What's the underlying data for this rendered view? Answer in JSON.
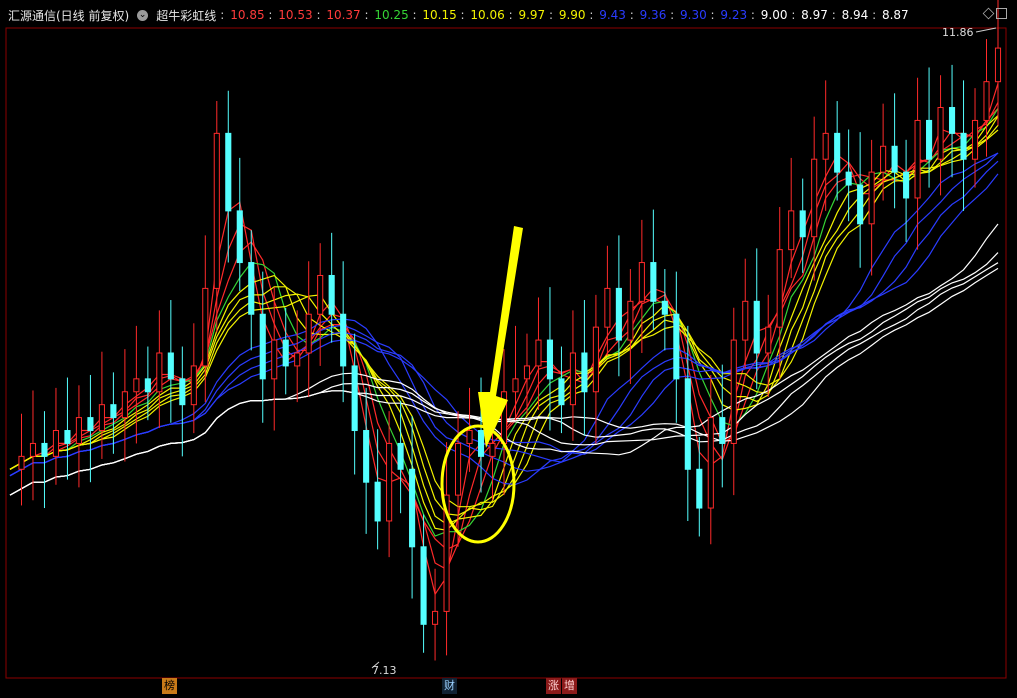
{
  "header": {
    "stock_title": "汇源通信(日线 前复权)",
    "indicator_name": "超牛彩虹线",
    "values": [
      {
        "text": "10.85",
        "color": "#ff3b3b"
      },
      {
        "text": "10.53",
        "color": "#ff3b3b"
      },
      {
        "text": "10.37",
        "color": "#ff3b3b"
      },
      {
        "text": "10.25",
        "color": "#35d435"
      },
      {
        "text": "10.15",
        "color": "#f2f200"
      },
      {
        "text": "10.06",
        "color": "#f2f200"
      },
      {
        "text": "9.97",
        "color": "#f2f200"
      },
      {
        "text": "9.90",
        "color": "#f2f200"
      },
      {
        "text": "9.43",
        "color": "#2a3cff"
      },
      {
        "text": "9.36",
        "color": "#2a3cff"
      },
      {
        "text": "9.30",
        "color": "#2a3cff"
      },
      {
        "text": "9.23",
        "color": "#2a3cff"
      },
      {
        "text": "9.00",
        "color": "#ffffff"
      },
      {
        "text": "8.97",
        "color": "#ffffff"
      },
      {
        "text": "8.94",
        "color": "#ffffff"
      },
      {
        "text": "8.87",
        "color": "#ffffff"
      }
    ]
  },
  "chart_data": {
    "type": "line",
    "peak_label": "11.86",
    "low_label": "7.13",
    "y_range": [
      7.0,
      12.0
    ],
    "colors": {
      "up_candle": "#ff2a2a",
      "down_candle": "#54ffff",
      "ma_red": "#ff2a2a",
      "ma_green": "#35d435",
      "ma_yellow": "#f2f200",
      "ma_blue": "#2a3cff",
      "ma_white": "#ffffff",
      "highlight": "#ffff00"
    },
    "close_path": [
      8.6,
      8.7,
      8.8,
      8.7,
      8.9,
      8.8,
      9.0,
      8.9,
      9.1,
      9.0,
      9.2,
      9.3,
      9.2,
      9.5,
      9.3,
      9.1,
      9.4,
      10.0,
      11.2,
      10.6,
      10.2,
      9.8,
      9.3,
      9.6,
      9.4,
      9.5,
      9.8,
      10.1,
      9.8,
      9.4,
      8.9,
      8.5,
      8.2,
      8.8,
      8.6,
      8.0,
      7.4,
      7.5,
      8.4,
      8.8,
      8.9,
      8.7,
      8.8,
      9.2,
      9.3,
      9.4,
      9.6,
      9.3,
      9.1,
      9.5,
      9.2,
      9.7,
      10.0,
      9.6,
      9.9,
      10.2,
      9.9,
      9.8,
      9.3,
      8.6,
      8.3,
      9.0,
      8.8,
      9.6,
      9.9,
      9.5,
      9.7,
      10.3,
      10.6,
      10.4,
      11.0,
      11.2,
      10.9,
      10.8,
      10.5,
      10.9,
      11.1,
      10.9,
      10.7,
      11.3,
      11.0,
      11.4,
      11.2,
      11.0,
      11.3,
      11.6,
      11.86
    ],
    "annotation": {
      "type": "arrow-and-ellipse",
      "color": "#ffff00"
    },
    "events": [
      "榜",
      "财",
      "涨",
      "增"
    ]
  }
}
